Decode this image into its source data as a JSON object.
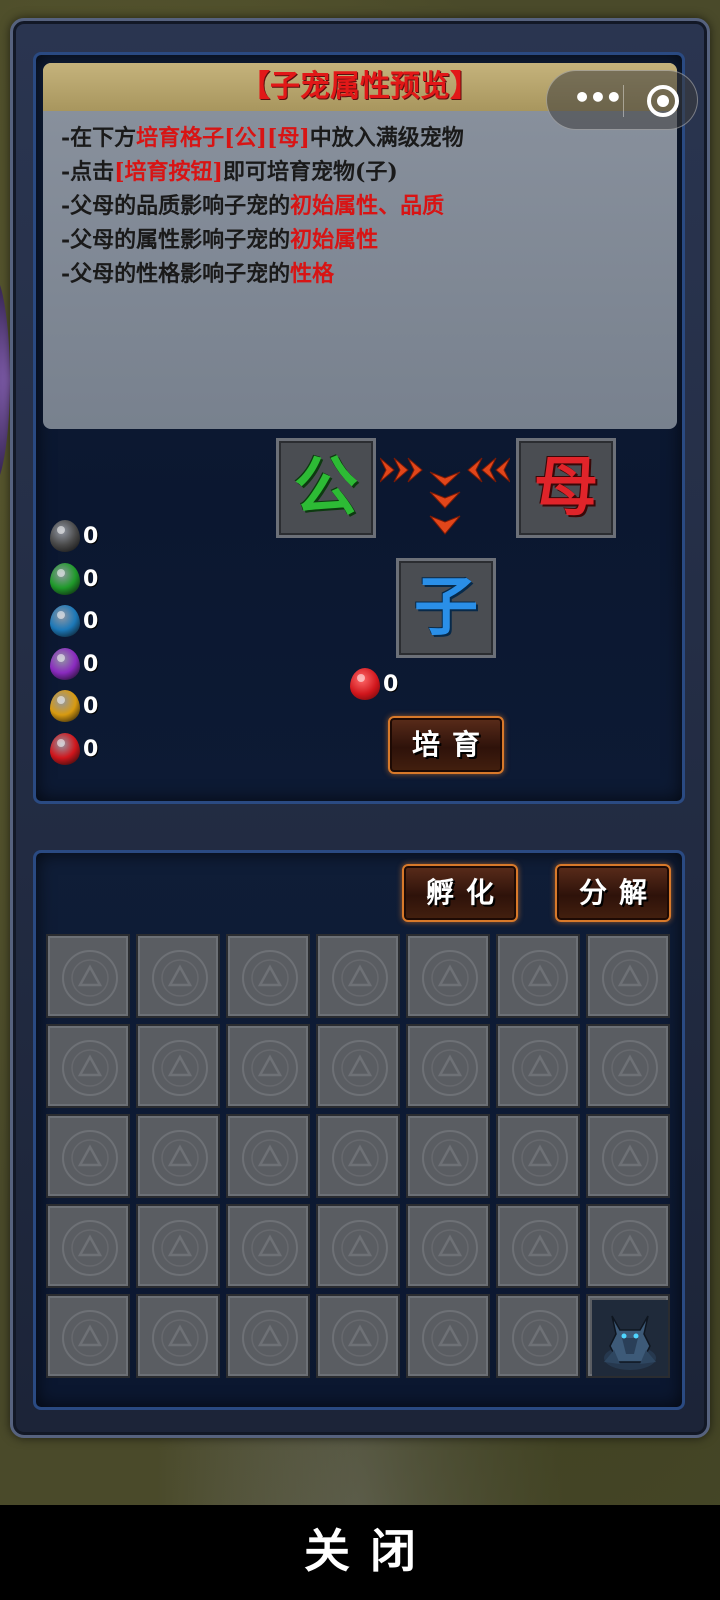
{
  "info": {
    "title": "【子宠属性预览】",
    "lines": [
      [
        {
          "t": "-在下方",
          "h": false
        },
        {
          "t": "培育格子[公][母]",
          "h": true
        },
        {
          "t": "中放入满级宠物",
          "h": false
        }
      ],
      [
        {
          "t": "-点击",
          "h": false
        },
        {
          "t": "[培育按钮]",
          "h": true
        },
        {
          "t": "即可培育宠物(子)",
          "h": false
        }
      ],
      [
        {
          "t": "-父母的品质影响子宠的",
          "h": false
        },
        {
          "t": "初始属性、品质",
          "h": true
        }
      ],
      [
        {
          "t": "-父母的属性影响子宠的",
          "h": false
        },
        {
          "t": "初始属性",
          "h": true
        }
      ],
      [
        {
          "t": "-父母的性格影响子宠的",
          "h": false
        },
        {
          "t": "性格",
          "h": true
        }
      ]
    ]
  },
  "breeding": {
    "male_label": "公",
    "female_label": "母",
    "child_label": "子",
    "cost_count": "0",
    "breed_button": "培育"
  },
  "gems": [
    {
      "name": "black-gem-icon",
      "color": "#4a4a4a",
      "count": "0"
    },
    {
      "name": "green-gem-icon",
      "color": "#1f9a2a",
      "count": "0"
    },
    {
      "name": "blue-gem-icon",
      "color": "#1c78b8",
      "count": "0"
    },
    {
      "name": "purple-gem-icon",
      "color": "#8a2abf",
      "count": "0"
    },
    {
      "name": "gold-gem-icon",
      "color": "#d89a10",
      "count": "0"
    },
    {
      "name": "red-gem-icon",
      "color": "#d0161c",
      "count": "0"
    }
  ],
  "inventory": {
    "hatch_button": "孵化",
    "decompose_button": "分解",
    "columns": 7,
    "rows": 5,
    "occupied_slot": 34,
    "occupied_icon": "wolf-pet-icon"
  },
  "close_label": "关闭",
  "colors": {
    "highlight_text": "#d81414",
    "button_border": "#d8792a"
  }
}
